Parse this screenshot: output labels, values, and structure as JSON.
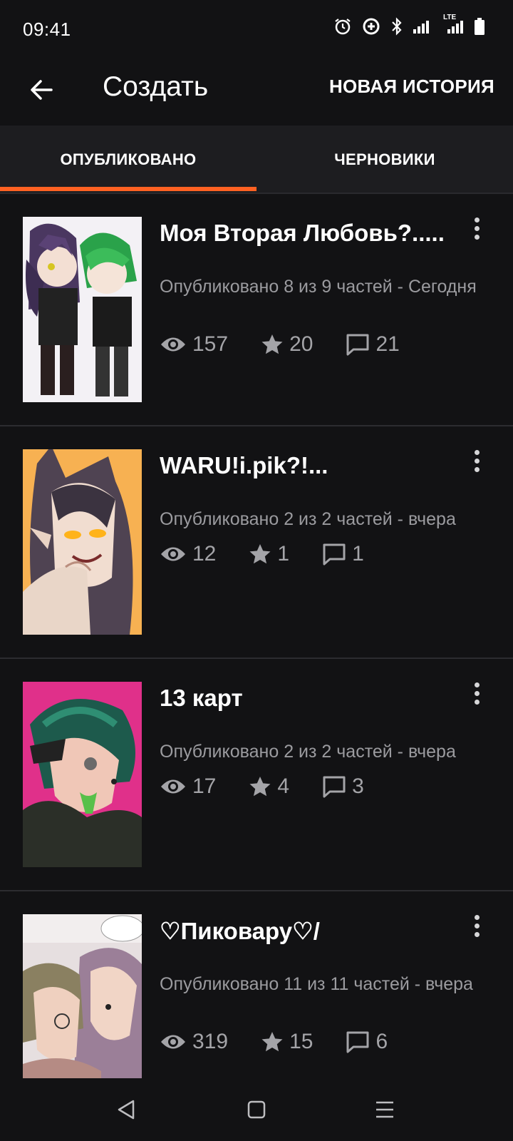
{
  "status_bar": {
    "time": "09:41",
    "icons": [
      "alarm-icon",
      "data-saver-icon",
      "bluetooth-icon",
      "signal-icon",
      "lte-signal-icon",
      "battery-icon"
    ],
    "lte_label": "LTE"
  },
  "app_bar": {
    "title": "Создать",
    "action_label": "НОВАЯ ИСТОРИЯ",
    "back_icon": "arrow-back-icon"
  },
  "tabs": [
    {
      "label": "ОПУБЛИКОВАНО",
      "selected": true
    },
    {
      "label": "ЧЕРНОВИКИ",
      "selected": false
    }
  ],
  "accent_color": "#ff6122",
  "stories": [
    {
      "title": "Моя Вторая Любовь?.....",
      "meta": "Опубликовано 8 из 9 частей - Сегодня",
      "views": "157",
      "votes": "20",
      "comments": "21"
    },
    {
      "title": "WARU!i.pik?!...",
      "meta": "Опубликовано 2 из 2 частей - вчера",
      "views": "12",
      "votes": "1",
      "comments": "1"
    },
    {
      "title": "13 карт",
      "meta": "Опубликовано 2 из 2 частей - вчера",
      "views": "17",
      "votes": "4",
      "comments": "3"
    },
    {
      "title": "♡Пиковару♡/",
      "meta": "Опубликовано 11 из 11 частей - вчера",
      "views": "319",
      "votes": "15",
      "comments": "6"
    }
  ],
  "nav_bar": {
    "icons": [
      "back-triangle-icon",
      "home-square-icon",
      "recents-menu-icon"
    ]
  }
}
